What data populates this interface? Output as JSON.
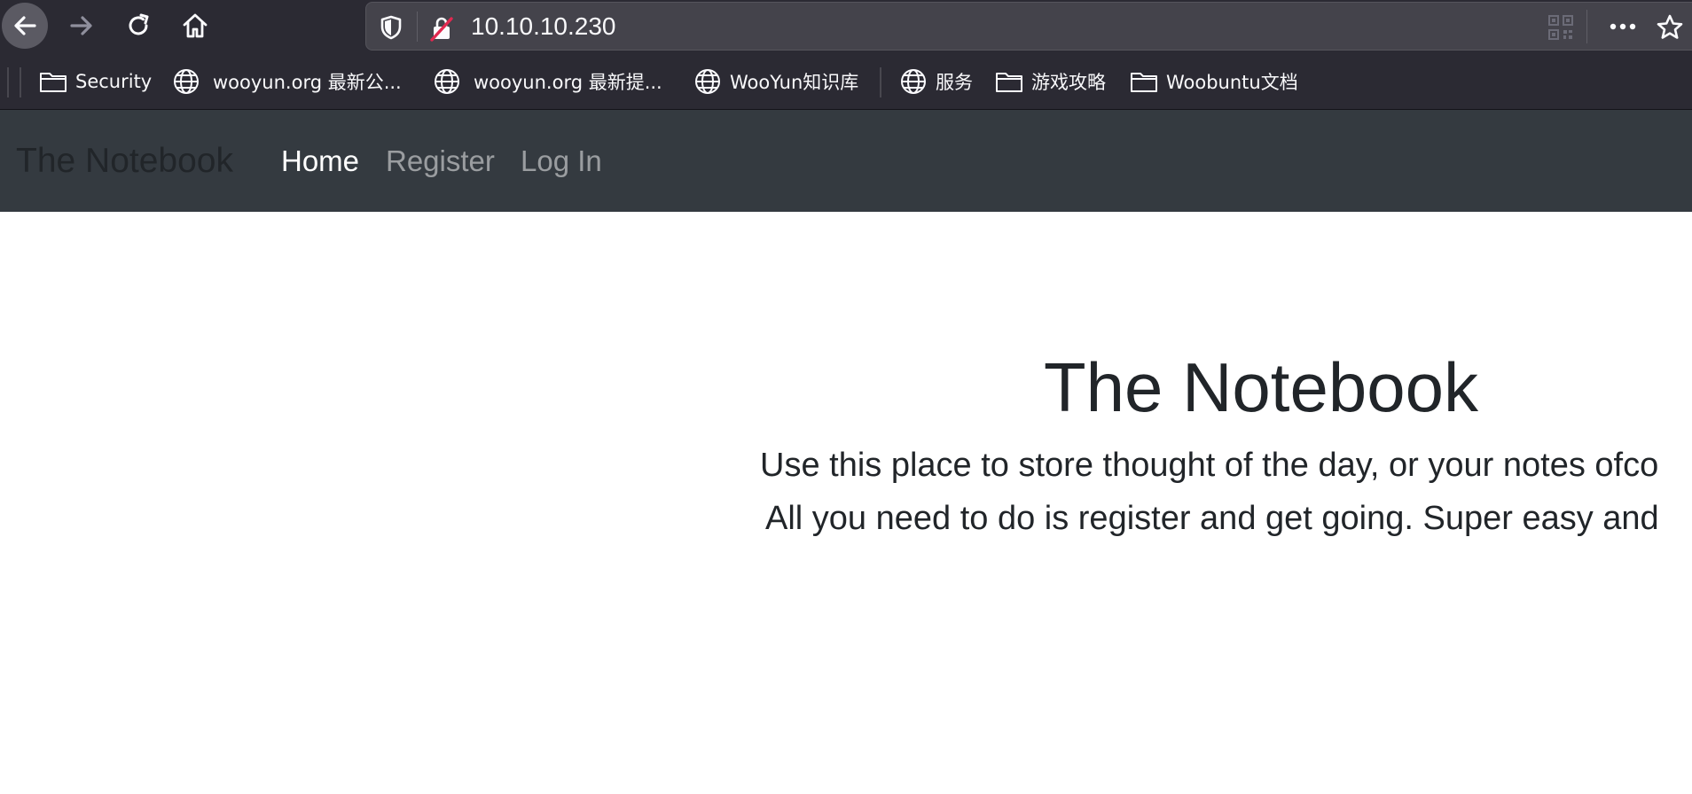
{
  "browser": {
    "address": "10.10.10.230",
    "icons": {
      "back": "arrow-left-icon",
      "forward": "arrow-right-icon",
      "reload": "reload-icon",
      "home": "home-icon",
      "shield": "tracking-shield-icon",
      "lock": "insecure-lock-icon",
      "qr": "qr-code-icon",
      "more": "more-dots-icon",
      "star": "bookmark-star-icon"
    }
  },
  "bookmarks": [
    {
      "label": "Security",
      "icon": "folder-icon"
    },
    {
      "label": "wooyun.org 最新公...",
      "icon": "globe-icon"
    },
    {
      "label": "wooyun.org 最新提...",
      "icon": "globe-icon"
    },
    {
      "label": "WooYun知识库",
      "icon": "globe-icon"
    },
    {
      "label": "服务",
      "icon": "globe-icon"
    },
    {
      "label": "游戏攻略",
      "icon": "folder-icon"
    },
    {
      "label": "Woobuntu文档",
      "icon": "folder-icon"
    }
  ],
  "site": {
    "brand": "The Notebook",
    "nav": {
      "home": "Home",
      "register": "Register",
      "login": "Log In"
    },
    "hero": {
      "title": "The Notebook",
      "line1": "Use this place to store thought of the day, or your notes ofco",
      "line2": "All you need to do is register and get going. Super easy and"
    }
  },
  "colors": {
    "browser_chrome": "#2b2a33",
    "urlbar": "#44434b",
    "navbar": "#343a40",
    "text_dark": "#212529",
    "lock_strike": "#e22850"
  }
}
